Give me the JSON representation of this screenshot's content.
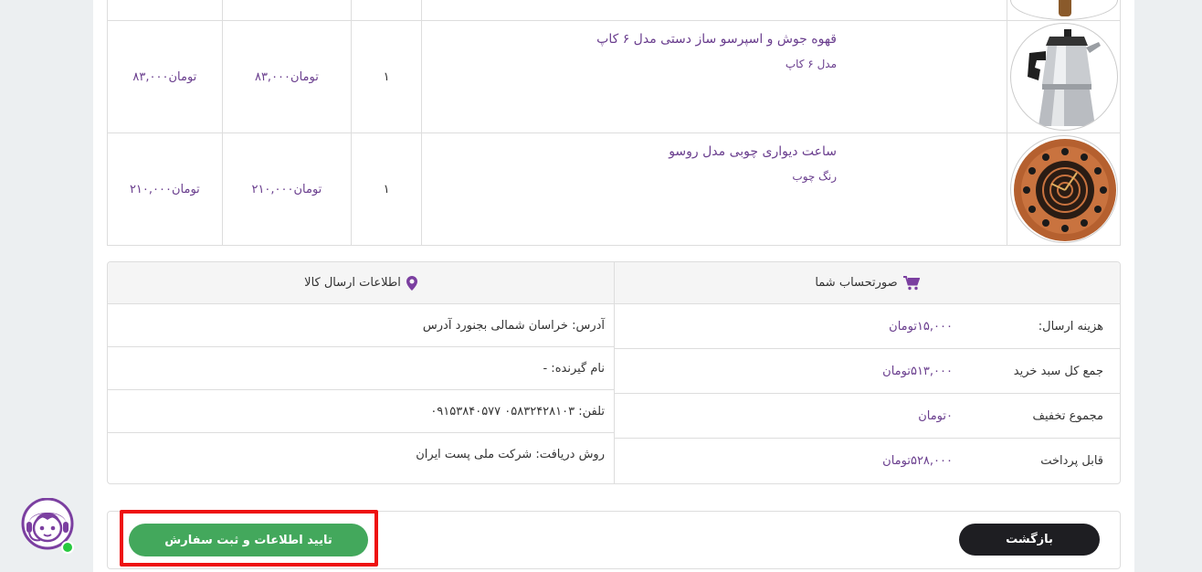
{
  "order_items": [
    {
      "name": "قهوه جوش و اسپرسو ساز دستی مدل ۶ کاپ",
      "variant": "مدل ۶ کاپ",
      "quantity": "۱",
      "unit_price": "۸۳,۰۰۰تومان",
      "total_price": "۸۳,۰۰۰تومان",
      "image": "moka-pot"
    },
    {
      "name": "ساعت دیواری چوبی مدل روسو",
      "variant": "رنگ چوب",
      "quantity": "۱",
      "unit_price": "۲۱۰,۰۰۰تومان",
      "total_price": "۲۱۰,۰۰۰تومان",
      "image": "wooden-wall-clock"
    }
  ],
  "invoice": {
    "title": "صورتحساب شما",
    "icon": "cart-icon",
    "rows": [
      {
        "label": "هزینه ارسال:",
        "value": "۱۵,۰۰۰تومان"
      },
      {
        "label": "جمع کل سبد خرید",
        "value": "۵۱۳,۰۰۰تومان"
      },
      {
        "label": "مجموع تخفیف",
        "value": "۰تومان"
      },
      {
        "label": "قابل پرداخت",
        "value": "۵۲۸,۰۰۰تومان"
      }
    ]
  },
  "shipping": {
    "title": "اطلاعات ارسال کالا",
    "icon": "map-marker-icon",
    "address": "آدرس: خراسان شمالی بجنورد آدرس",
    "recipient": "نام گیرنده: -",
    "phone": "تلفن: ۰۵۸۳۲۴۲۸۱۰۳ ۰۹۱۵۳۸۴۰۵۷۷",
    "delivery_method": "روش دریافت: شرکت ملی پست ایران"
  },
  "actions": {
    "back_label": "بازگشت",
    "confirm_label": "تایید اطلاعات و ثبت سفارش"
  },
  "colors": {
    "accent": "#6a3e8e",
    "confirm": "#43a85c",
    "back": "#1e1e22",
    "highlight": "#ee1111",
    "online": "#27c93f"
  }
}
